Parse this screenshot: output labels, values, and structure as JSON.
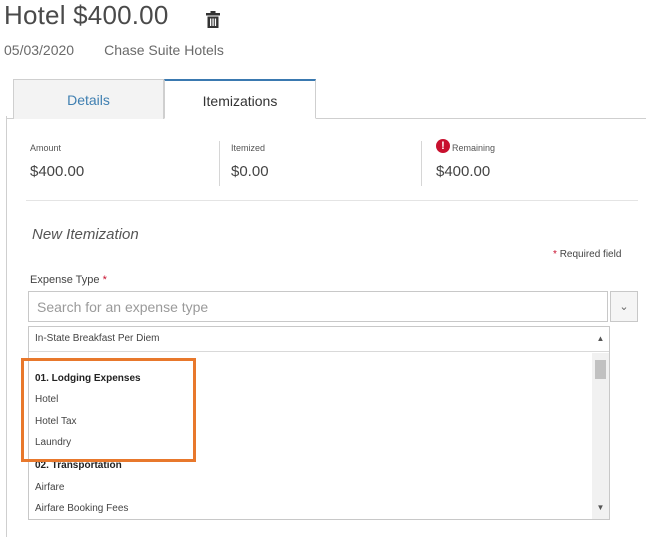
{
  "header": {
    "title": "Hotel $400.00",
    "date": "05/03/2020",
    "vendor": "Chase Suite Hotels"
  },
  "tabs": [
    {
      "label": "Details",
      "active": false
    },
    {
      "label": "Itemizations",
      "active": true
    }
  ],
  "summary": {
    "amount": {
      "label": "Amount",
      "value": "$400.00"
    },
    "itemized": {
      "label": "Itemized",
      "value": "$0.00"
    },
    "remaining": {
      "label": "Remaining",
      "value": "$400.00",
      "alert_icon": "exclamation-icon"
    }
  },
  "form": {
    "section_title": "New Itemization",
    "required_note": "Required field",
    "required_star": "*",
    "expense_type_label": "Expense Type",
    "search_placeholder": "Search for an expense type"
  },
  "dropdown": {
    "first_item": "In-State Breakfast Per Diem",
    "items": [
      {
        "label": "01. Lodging Expenses",
        "group": true
      },
      {
        "label": "Hotel",
        "group": false
      },
      {
        "label": "Hotel Tax",
        "group": false
      },
      {
        "label": "Laundry",
        "group": false
      },
      {
        "label": "02. Transportation",
        "group": true
      },
      {
        "label": "Airfare",
        "group": false
      },
      {
        "label": "Airfare Booking Fees",
        "group": false
      }
    ]
  },
  "colors": {
    "highlight": "#e8782c",
    "accent": "#3a79b0",
    "alert": "#c8102e"
  }
}
